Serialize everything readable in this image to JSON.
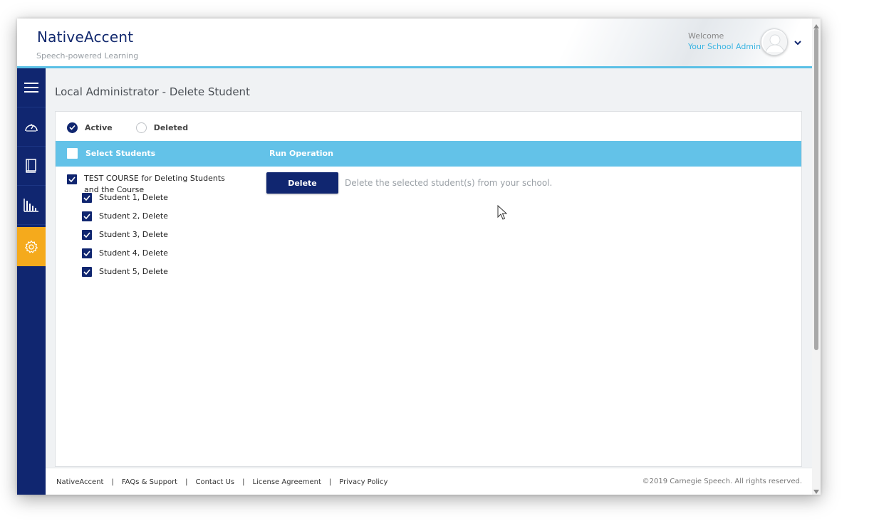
{
  "header": {
    "brand": "NativeAccent",
    "tagline": "Speech-powered Learning",
    "welcome": "Welcome",
    "user": "Your School Admin"
  },
  "sidebar": {
    "items": [
      {
        "icon": "menu-icon"
      },
      {
        "icon": "dashboard-gauge-icon"
      },
      {
        "icon": "book-icon"
      },
      {
        "icon": "bar-chart-icon"
      },
      {
        "icon": "gear-icon",
        "active": true
      }
    ]
  },
  "page": {
    "title": "Local Administrator - Delete Student"
  },
  "filter": {
    "active_label": "Active",
    "deleted_label": "Deleted",
    "selected": "Active"
  },
  "table": {
    "col_select": "Select Students",
    "col_run": "Run Operation",
    "course": "TEST COURSE for Deleting Students and the Course",
    "students": [
      {
        "name": "Student 1, Delete",
        "checked": true
      },
      {
        "name": "Student 2, Delete",
        "checked": true
      },
      {
        "name": "Student 3, Delete",
        "checked": true
      },
      {
        "name": "Student 4, Delete",
        "checked": true
      },
      {
        "name": "Student 5, Delete",
        "checked": true
      }
    ]
  },
  "operation": {
    "delete_label": "Delete",
    "delete_description": "Delete the selected student(s) from your school."
  },
  "footer": {
    "links": [
      "NativeAccent",
      "FAQs & Support",
      "Contact Us",
      "License Agreement",
      "Privacy Policy"
    ],
    "separator": "|",
    "copyright": "©2019 Carnegie Speech. All rights reserved."
  },
  "colors": {
    "navy": "#102670",
    "sky": "#63c2e8",
    "accent": "#f5aa1c"
  }
}
